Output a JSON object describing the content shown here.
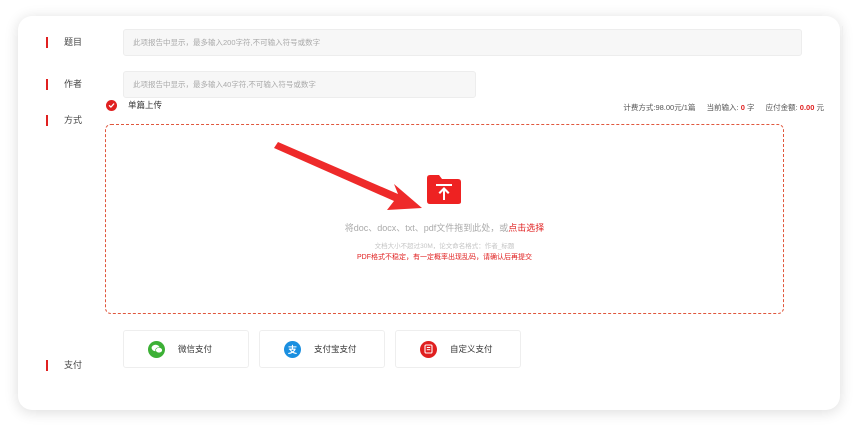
{
  "form": {
    "title_label": "题目",
    "title_placeholder": "此项报告中显示，最多输入200字符,不可输入符号或数字",
    "author_label": "作者",
    "author_placeholder": "此项报告中显示，最多输入40字符,不可输入符号或数字",
    "mode_label": "方式",
    "mode_option": "单篇上传"
  },
  "pricing": {
    "method": "计费方式:98.00元/1篇",
    "current_label": "当前输入:",
    "current_value": "0",
    "current_unit": "字",
    "due_label": "应付金额:",
    "due_value": "0.00",
    "due_unit": "元"
  },
  "dropzone": {
    "main_text": "将doc、docx、txt、pdf文件拖到此处，或",
    "select_link": "点击选择",
    "note_size": "文档大小不超过30M，论文命名格式：作者_标题",
    "note_pdf": "PDF格式不稳定，有一定概率出现乱码，请确认后再提交"
  },
  "payment": {
    "label": "支付",
    "options": [
      {
        "label": "微信支付",
        "icon": "wechat-icon",
        "color": "#3cb035"
      },
      {
        "label": "支付宝支付",
        "icon": "alipay-icon",
        "color": "#1a8fe0"
      },
      {
        "label": "自定义支付",
        "icon": "custom-pay-icon",
        "color": "#e02020"
      }
    ]
  },
  "colors": {
    "accent": "#e02020",
    "upload_icon": "#ee2222"
  }
}
